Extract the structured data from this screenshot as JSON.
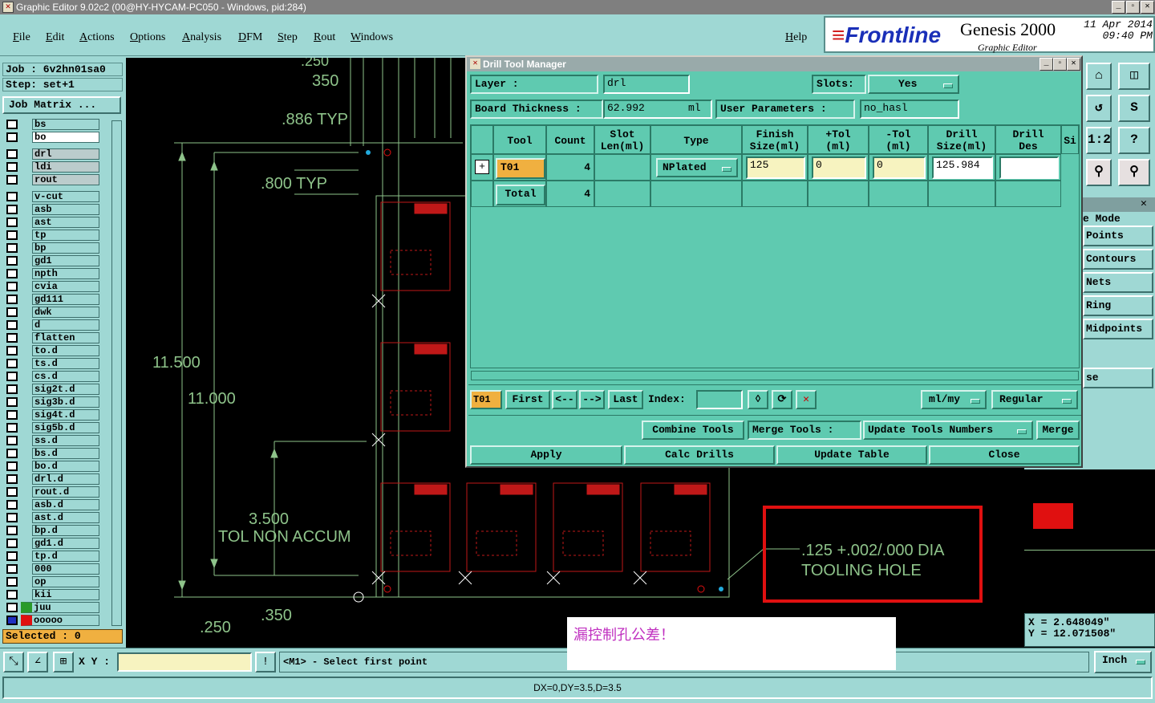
{
  "window": {
    "title": "Graphic Editor 9.02c2 (00@HY-HYCAM-PC050 - Windows, pid:284)"
  },
  "menu": [
    "File",
    "Edit",
    "Actions",
    "Options",
    "Analysis",
    "DFM",
    "Step",
    "Rout",
    "Windows"
  ],
  "help": "Help",
  "brand": {
    "logo": "Frontline",
    "product": "Genesis 2000",
    "subtitle": "Graphic Editor",
    "date": "11 Apr 2014",
    "time": "09:40 PM"
  },
  "left": {
    "job": "Job : 6v2hn01sa0",
    "step": "Step: set+1",
    "job_matrix": "Job Matrix ...",
    "layers": [
      "bs",
      "bo",
      "drl",
      "ldi",
      "rout",
      "v-cut",
      "asb",
      "ast",
      "tp",
      "bp",
      "gd1",
      "npth",
      "cvia",
      "gd111",
      "dwk",
      "d",
      "flatten",
      "to.d",
      "ts.d",
      "cs.d",
      "sig2t.d",
      "sig3b.d",
      "sig4t.d",
      "sig5b.d",
      "ss.d",
      "bs.d",
      "bo.d",
      "drl.d",
      "rout.d",
      "asb.d",
      "ast.d",
      "bp.d",
      "gd1.d",
      "tp.d",
      "000",
      "op",
      "kii",
      "juu",
      "ooooo"
    ],
    "selected": "Selected : 0"
  },
  "dialog": {
    "title": "Drill Tool Manager",
    "layer_label": "Layer          :",
    "layer_value": "drl",
    "slots_label": "Slots:",
    "slots_value": "Yes",
    "board_label": "Board Thickness :",
    "board_value": "62.992",
    "board_unit": "ml",
    "user_params_label": "User Parameters :",
    "user_params_value": "no_hasl",
    "headers": [
      "Tool",
      "Count",
      "Slot\nLen(ml)",
      "Type",
      "Finish\nSize(ml)",
      "+Tol\n(ml)",
      "-Tol\n(ml)",
      "Drill\nSize(ml)",
      "Drill\nDes",
      "Si"
    ],
    "row1": {
      "plus": "+",
      "tool": "T01",
      "count": "4",
      "type": "NPlated",
      "finish": "125",
      "ptol": "0",
      "mtol": "0",
      "drill": "125.984",
      "des": ""
    },
    "total": {
      "label": "Total",
      "count": "4"
    },
    "nav": {
      "current": "T01",
      "first": "First",
      "prev": "<--",
      "next": "-->",
      "last": "Last",
      "index_label": "Index:",
      "units": "ml/my",
      "mode": "Regular"
    },
    "combine": "Combine Tools",
    "merge_label": "Merge Tools :",
    "update_numbers": "Update Tools Numbers",
    "merge": "Merge",
    "apply": "Apply",
    "calc": "Calc Drills",
    "update_table": "Update Table",
    "close": "Close"
  },
  "canvas": {
    "dims": [
      "350",
      ".886 TYP",
      ".800 TYP",
      "11.500",
      "11.000",
      "3.500",
      "TOL NON ACCUM",
      ".250",
      ".350",
      ".250"
    ],
    "note_line1": ".125 +.002/.000 DIA",
    "note_line2": "TOOLING HOLE"
  },
  "right": {
    "mode_label": "e Mode",
    "modes": [
      "Points",
      "Contours",
      "Nets",
      "Ring",
      "Midpoints"
    ],
    "se": "se"
  },
  "coords": {
    "x": "X = 2.648049\"",
    "y": "Y = 12.071508\""
  },
  "bottom": {
    "xy_label": "X Y :",
    "prompt": "<M1> - Select first point",
    "units": "Inch",
    "status": "DX=0,DY=3.5,D=3.5"
  },
  "annotation": "漏控制孔公差！"
}
